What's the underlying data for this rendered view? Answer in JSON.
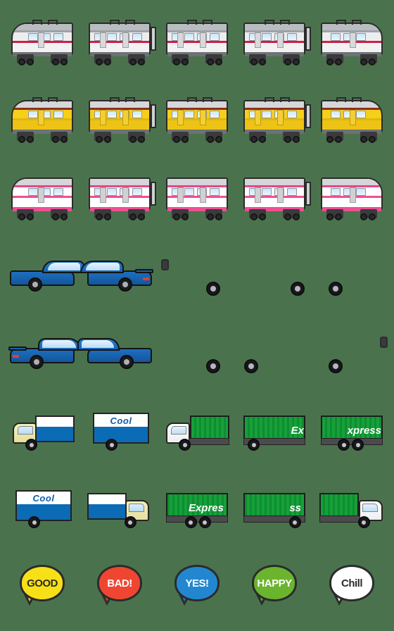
{
  "sheet": {
    "title": "Vehicle & Speech Bubble Emoji Sheet",
    "background_color": "#4a734d",
    "columns": 5,
    "rows": 8,
    "cell_size_px": 110
  },
  "palette": {
    "background": "#4a734d",
    "train_silver": "#e9e9ea",
    "train_red_stripe": "#cf1f46",
    "train_yellow": "#f6cf18",
    "train_pink": "#ef4f94",
    "car_blue": "#1e6fc0",
    "bus_silver": "#e3e4e6",
    "bus_blue": "#1b6fc0",
    "truck_blue": "#0b6bb5",
    "container_green": "#15a13a",
    "outline": "#2b2b2b"
  },
  "rows": [
    {
      "name": "silver-commuter-train",
      "label": "Silver commuter train",
      "cells": [
        {
          "name": "train-head-car-left",
          "kind": "train-nose-left"
        },
        {
          "name": "train-middle-car-coupled",
          "kind": "train-mid-coupler"
        },
        {
          "name": "train-middle-car",
          "kind": "train-mid"
        },
        {
          "name": "train-middle-car-coupled-2",
          "kind": "train-mid-coupler"
        },
        {
          "name": "train-tail-car-right",
          "kind": "train-nose-right"
        }
      ]
    },
    {
      "name": "yellow-tram-train",
      "label": "Yellow tram train",
      "cells": [
        {
          "name": "yellow-train-head-car-left",
          "kind": "train-nose-left"
        },
        {
          "name": "yellow-train-middle-car-coupled",
          "kind": "train-mid-coupler"
        },
        {
          "name": "yellow-train-middle-car",
          "kind": "train-mid"
        },
        {
          "name": "yellow-train-middle-car-coupled-2",
          "kind": "train-mid-coupler"
        },
        {
          "name": "yellow-train-tail-car-right",
          "kind": "train-nose-right"
        }
      ]
    },
    {
      "name": "pink-commuter-train",
      "label": "Pink commuter train",
      "cells": [
        {
          "name": "pink-train-head-car-left",
          "kind": "train-nose-left"
        },
        {
          "name": "pink-train-middle-car-coupled",
          "kind": "train-mid-coupler"
        },
        {
          "name": "pink-train-middle-car",
          "kind": "train-mid"
        },
        {
          "name": "pink-train-middle-car-coupled-2",
          "kind": "train-mid-coupler"
        },
        {
          "name": "pink-train-tail-car-right",
          "kind": "train-nose-right"
        }
      ]
    },
    {
      "name": "blue-sports-car-and-bus-left",
      "label": "Blue sports car and city bus facing left",
      "cells": [
        {
          "name": "sports-car-front-half-left",
          "kind": "car-front-left"
        },
        {
          "name": "sports-car-rear-half-left",
          "kind": "car-rear-left"
        },
        {
          "name": "bus-front-half-left",
          "kind": "bus-front-left"
        },
        {
          "name": "bus-middle-section-left",
          "kind": "bus-mid"
        },
        {
          "name": "bus-rear-half-left",
          "kind": "bus-rear-left"
        }
      ]
    },
    {
      "name": "blue-sports-car-and-bus-right",
      "label": "Blue sports car and city bus facing right",
      "cells": [
        {
          "name": "sports-car-rear-half-right",
          "kind": "car-rear-right"
        },
        {
          "name": "sports-car-front-half-right",
          "kind": "car-front-right"
        },
        {
          "name": "bus-rear-half-right",
          "kind": "bus-rear-right"
        },
        {
          "name": "bus-middle-section-right",
          "kind": "bus-mid-r"
        },
        {
          "name": "bus-front-half-right",
          "kind": "bus-front-right"
        }
      ]
    },
    {
      "name": "delivery-trucks-left",
      "label": "Refrigerated and container trucks facing left",
      "cells": [
        {
          "name": "cool-truck-cab-left",
          "kind": "cool-cab-left"
        },
        {
          "name": "cool-truck-box-left",
          "kind": "cool-box",
          "text": "Cool"
        },
        {
          "name": "express-truck-cab-left",
          "kind": "express-cab-left"
        },
        {
          "name": "express-trailer-front-left",
          "kind": "express-trailer",
          "text": "Ex"
        },
        {
          "name": "express-trailer-rear-left",
          "kind": "express-bogie",
          "text": "xpress"
        }
      ]
    },
    {
      "name": "delivery-trucks-right",
      "label": "Refrigerated and container trucks facing right",
      "cells": [
        {
          "name": "cool-truck-box-right",
          "kind": "cool-box",
          "text": "Cool"
        },
        {
          "name": "cool-truck-cab-right",
          "kind": "cool-cab-right"
        },
        {
          "name": "express-trailer-rear-right",
          "kind": "express-bogie-r",
          "text": "Expres"
        },
        {
          "name": "express-trailer-front-right",
          "kind": "express-trailer-r",
          "text": "ss"
        },
        {
          "name": "express-truck-cab-right",
          "kind": "express-cab-right"
        }
      ]
    },
    {
      "name": "speech-bubbles",
      "label": "Word speech bubbles",
      "cells": [
        {
          "name": "speech-bubble-good",
          "kind": "bubble",
          "text": "GOOD",
          "fill": "#f7e017",
          "text_color": "#2b2b2b"
        },
        {
          "name": "speech-bubble-bad",
          "kind": "bubble",
          "text": "BAD!",
          "fill": "#ef4632",
          "text_color": "#ffffff"
        },
        {
          "name": "speech-bubble-yes",
          "kind": "bubble",
          "text": "YES!",
          "fill": "#2287d0",
          "text_color": "#ffffff"
        },
        {
          "name": "speech-bubble-happy",
          "kind": "bubble",
          "text": "HAPPY",
          "fill": "#6ab42e",
          "text_color": "#ffffff"
        },
        {
          "name": "speech-bubble-chill",
          "kind": "bubble",
          "text": "Chill",
          "fill": "#ffffff",
          "text_color": "#2b2b2b"
        }
      ]
    }
  ]
}
